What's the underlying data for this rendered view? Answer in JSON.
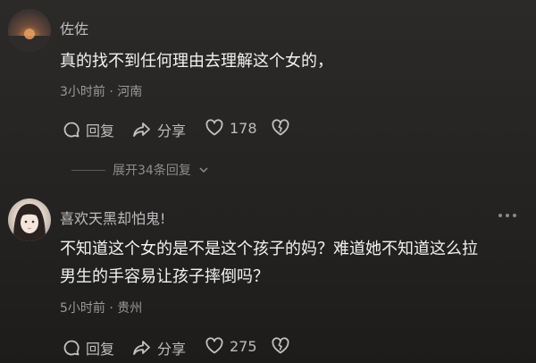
{
  "comments": [
    {
      "username": "佐佐",
      "content_lines": [
        "真的找不到任何理由去理解这个女的，"
      ],
      "meta": "3小时前 · 河南",
      "actions": {
        "reply": "回复",
        "share": "分享",
        "like_count": "178"
      }
    },
    {
      "username": "喜欢天黑却怕鬼!",
      "content_lines": [
        "不知道这个女的是不是这个孩子的妈？难道她不知道这么拉",
        "男生的手容易让孩子摔倒吗？"
      ],
      "meta": "5小时前 · 贵州",
      "actions": {
        "reply": "回复",
        "share": "分享",
        "like_count": "275"
      }
    }
  ],
  "expand_replies": "展开34条回复",
  "icons": {
    "reply": "comment-bubble-icon",
    "share": "share-arrow-icon",
    "like": "heart-icon",
    "dislike": "broken-heart-icon",
    "more": "more-dots-icon",
    "chevron": "chevron-down-icon"
  }
}
